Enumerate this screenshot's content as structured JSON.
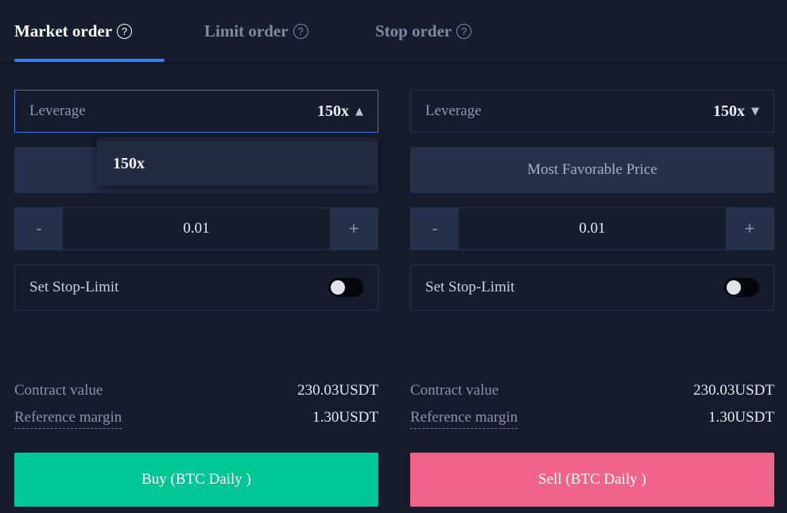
{
  "tabs": [
    {
      "label": "Market order",
      "active": true
    },
    {
      "label": "Limit order",
      "active": false
    },
    {
      "label": "Stop order",
      "active": false
    }
  ],
  "help_icon_glyph": "?",
  "left": {
    "leverage_label": "Leverage",
    "leverage_value": "150x",
    "leverage_caret": "▲",
    "dropdown_option": "150x",
    "quantity": "0.01",
    "minus": "-",
    "plus": "+",
    "stop_limit_label": "Set Stop-Limit",
    "stop_limit_on": false,
    "contract_value_label": "Contract value",
    "contract_value": "230.03USDT",
    "reference_margin_label": "Reference margin",
    "reference_margin": "1.30USDT",
    "action_label": "Buy (BTC Daily )"
  },
  "right": {
    "leverage_label": "Leverage",
    "leverage_value": "150x",
    "leverage_caret": "▼",
    "price_label": "Most Favorable Price",
    "quantity": "0.01",
    "minus": "-",
    "plus": "+",
    "stop_limit_label": "Set Stop-Limit",
    "stop_limit_on": false,
    "contract_value_label": "Contract value",
    "contract_value": "230.03USDT",
    "reference_margin_label": "Reference margin",
    "reference_margin": "1.30USDT",
    "action_label": "Sell (BTC Daily )"
  },
  "colors": {
    "background": "#151c2c",
    "accent": "#3f7de6",
    "buy": "#00c795",
    "sell": "#f0648a"
  }
}
